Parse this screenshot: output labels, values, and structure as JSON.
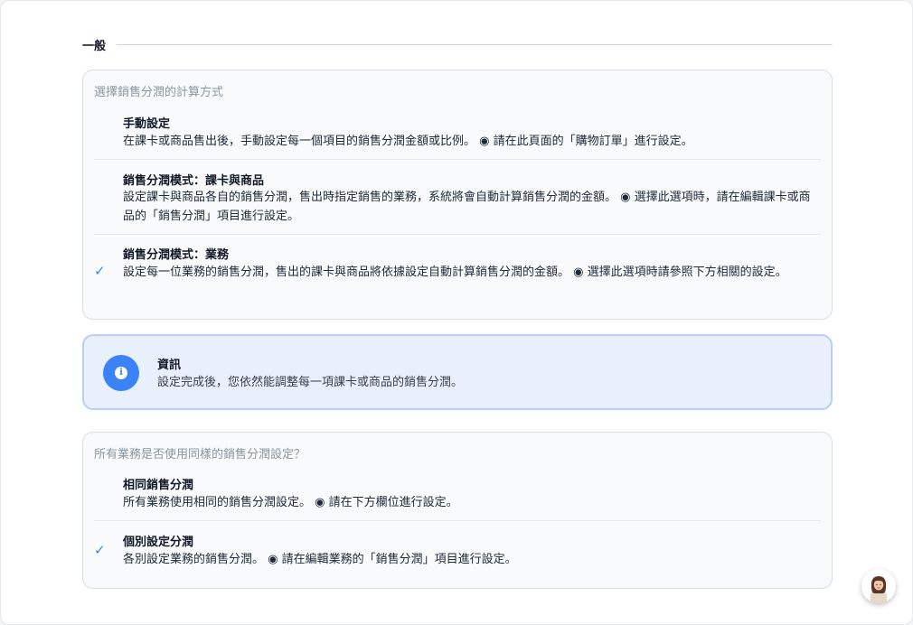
{
  "section": {
    "title": "一般"
  },
  "calc_card": {
    "question": "選擇銷售分潤的計算方式",
    "options": [
      {
        "title": "手動設定",
        "desc": "在課卡或商品售出後，手動設定每一個項目的銷售分潤金額或比例。 ◉ 請在此頁面的「購物訂單」進行設定。",
        "selected": false
      },
      {
        "title": "銷售分潤模式：課卡與商品",
        "desc": "設定課卡與商品各自的銷售分潤，售出時指定銷售的業務，系統將會自動計算銷售分潤的金額。 ◉ 選擇此選項時，請在編輯課卡或商品的「銷售分潤」項目進行設定。",
        "selected": false
      },
      {
        "title": "銷售分潤模式：業務",
        "desc": "設定每一位業務的銷售分潤，售出的課卡與商品將依據設定自動計算銷售分潤的金額。 ◉ 選擇此選項時請參照下方相關的設定。",
        "selected": true
      }
    ]
  },
  "info": {
    "title": "資訊",
    "text": "設定完成後，您依然能調整每一項課卡或商品的銷售分潤。",
    "icon": "info-icon"
  },
  "same_card": {
    "question": "所有業務是否使用同樣的銷售分潤設定？",
    "options": [
      {
        "title": "相同銷售分潤",
        "desc": "所有業務使用相同的銷售分潤設定。 ◉ 請在下方欄位進行設定。",
        "selected": false
      },
      {
        "title": "個別設定分潤",
        "desc": "各別設定業務的銷售分潤。 ◉ 請在編輯業務的「銷售分潤」項目進行設定。",
        "selected": true
      }
    ]
  },
  "check_symbol": "✓",
  "info_symbol": "i",
  "colors": {
    "accent": "#3b82f6",
    "info_bg": "#e8f0fb",
    "info_border": "#b9cff0"
  }
}
